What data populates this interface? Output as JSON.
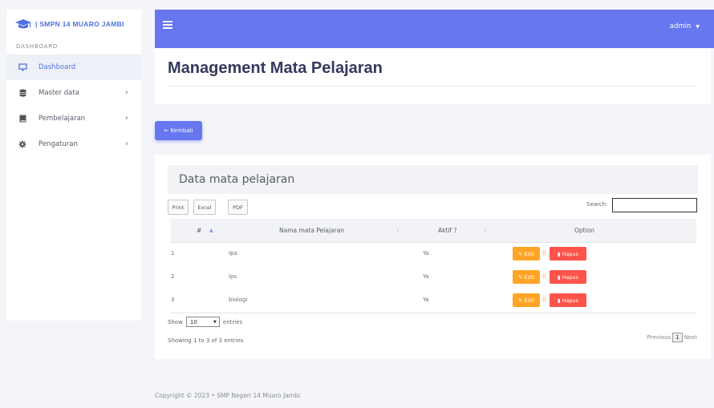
{
  "brand": {
    "name": "| SMPN 14 MUARO JAMBI",
    "icon": "graduation-cap-icon"
  },
  "sidebar": {
    "heading": "DASHBOARD",
    "items": [
      {
        "label": "Dashboard",
        "icon": "desktop-icon",
        "active": true
      },
      {
        "label": "Master data",
        "icon": "database-icon"
      },
      {
        "label": "Pembelajaran",
        "icon": "book-icon"
      },
      {
        "label": "Pengaturan",
        "icon": "cog-icon"
      }
    ]
  },
  "topbar": {
    "user": "admin"
  },
  "page": {
    "title": "Management Mata Pelajaran"
  },
  "back_button": {
    "label": "← Kembali"
  },
  "card": {
    "title": "Data mata pelajaran"
  },
  "toolbar": {
    "print": "Print",
    "excel": "Excel",
    "pdf": "PDF",
    "search_label": "Search:"
  },
  "table": {
    "headers": [
      "#",
      "Nama mata Pelajaran",
      "Aktif ?",
      "Option"
    ],
    "rows": [
      {
        "no": "1",
        "nama": "Ipa",
        "aktif": "Ya"
      },
      {
        "no": "2",
        "nama": "ips",
        "aktif": "Ya"
      },
      {
        "no": "3",
        "nama": "biologi",
        "aktif": "Ya"
      }
    ],
    "edit_label": "Edit",
    "separator": "||",
    "delete_label": "Hapus"
  },
  "entries": {
    "show": "Show",
    "value": "10",
    "suffix": "entries"
  },
  "info": "Showing 1 to 3 of 3 entries",
  "pagination": {
    "previous": "Previous",
    "current": "1",
    "next": "Next"
  },
  "footer": "Copyright © 2023 • SMP Negeri 14 Muaro Jambi",
  "colors": {
    "primary": "#6777ef",
    "warning": "#ffa426",
    "danger": "#fc544b"
  }
}
